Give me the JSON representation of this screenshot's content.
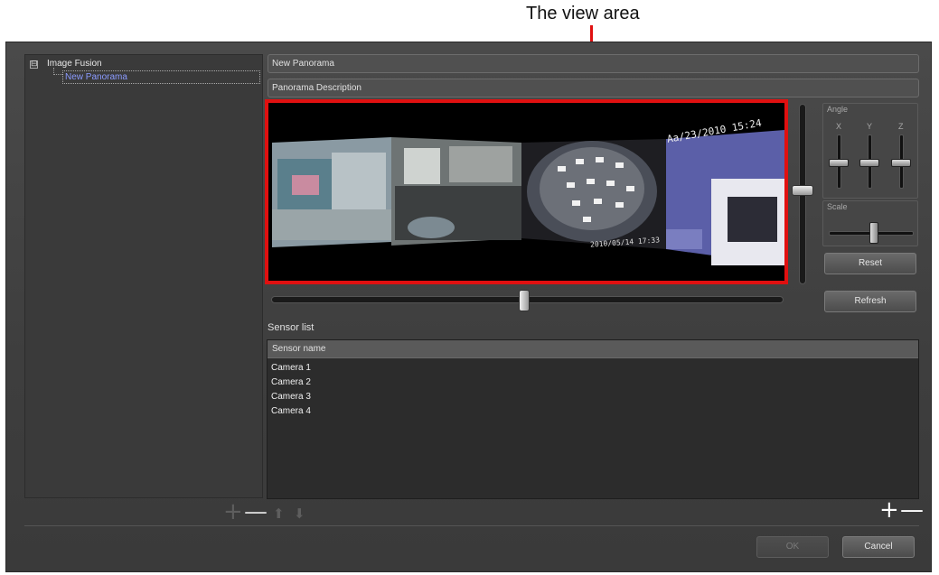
{
  "annotation": {
    "label": "The view area"
  },
  "tree": {
    "expander": "⊟",
    "root_label": "Image Fusion",
    "child_label": "New Panorama"
  },
  "panorama": {
    "title": "New Panorama",
    "description": "Panorama Description"
  },
  "view": {
    "timestamp_top": "Aa/23/2010 15:24",
    "timestamp_bottom": "2010/05/14 17:33"
  },
  "angle": {
    "title": "Angle",
    "axes": [
      "X",
      "Y",
      "Z"
    ]
  },
  "scale": {
    "title": "Scale"
  },
  "buttons": {
    "reset": "Reset",
    "refresh": "Refresh",
    "ok": "OK",
    "cancel": "Cancel"
  },
  "sensor_list": {
    "label": "Sensor list",
    "column_header": "Sensor name",
    "rows": [
      "Camera 1",
      "Camera 2",
      "Camera 3",
      "Camera 4"
    ]
  },
  "icons": {
    "tree_add": "plus-icon",
    "tree_remove": "minus-icon",
    "tree_up": "arrow-up-icon",
    "tree_down": "arrow-down-icon",
    "sensor_add": "plus-icon",
    "sensor_remove": "minus-icon"
  },
  "colors": {
    "highlight": "#e01010",
    "dialog_bg": "#444444",
    "tree_selection_text": "#8b9bff"
  }
}
